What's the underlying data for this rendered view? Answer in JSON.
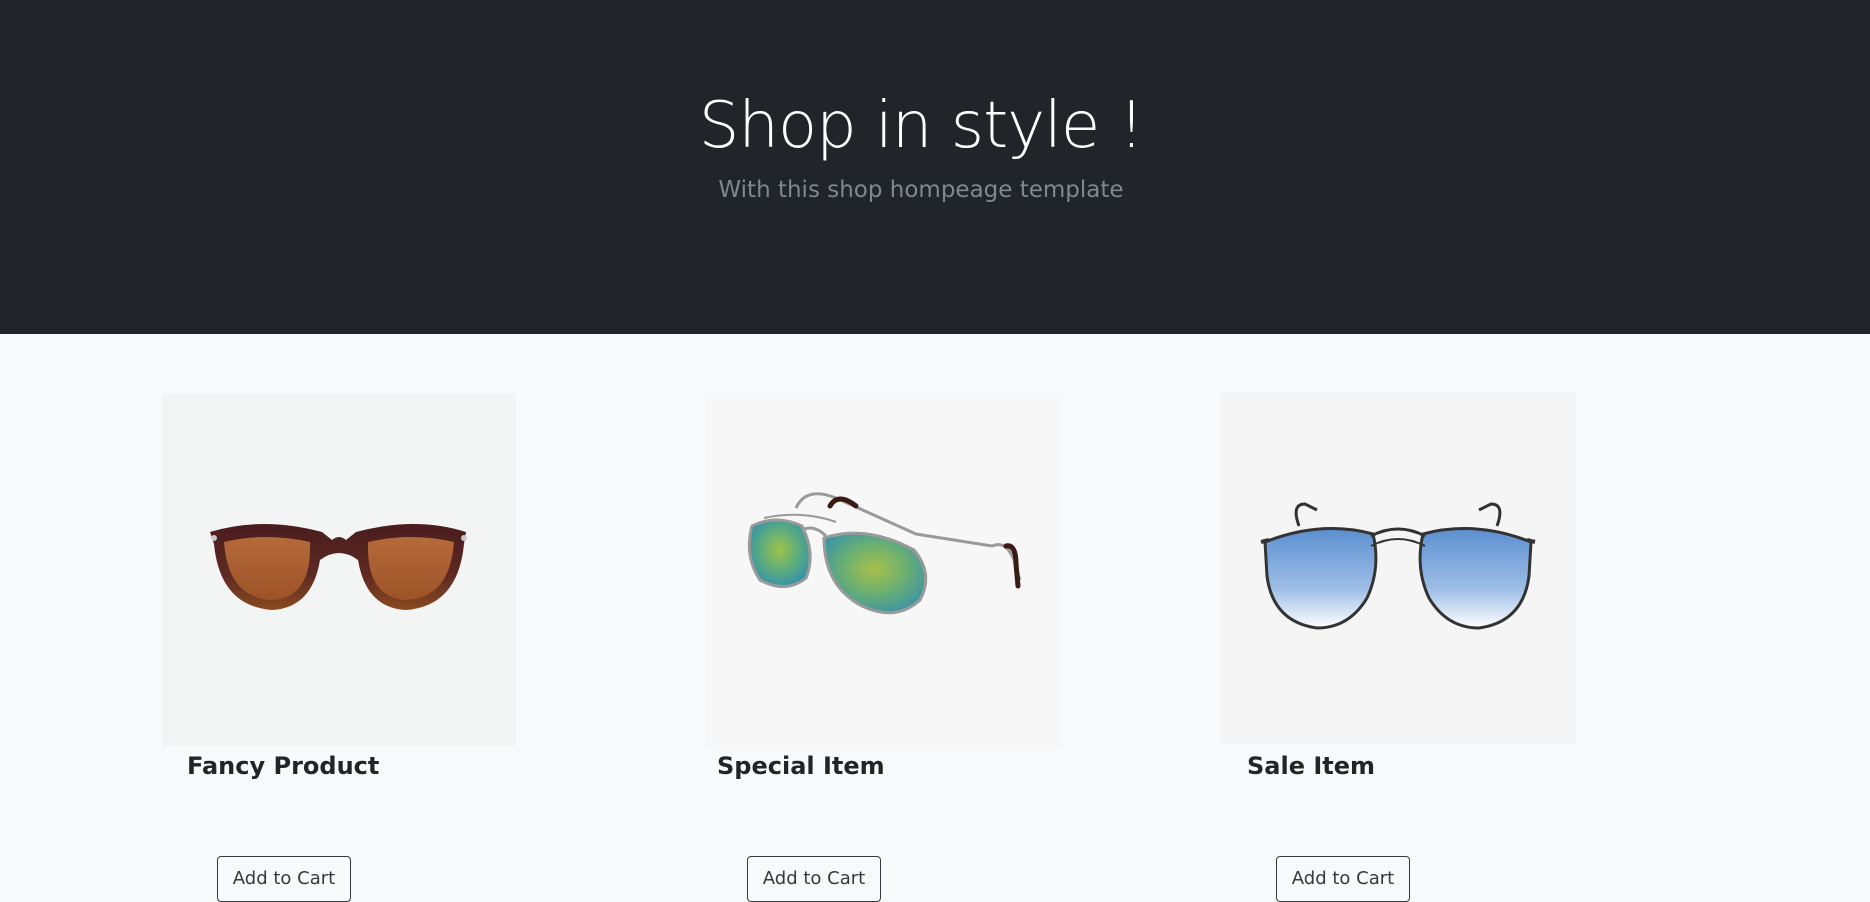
{
  "hero": {
    "title": "Shop in style !",
    "subtitle": "With this shop hompeage template"
  },
  "colors": {
    "hero_background": "#212529",
    "page_background": "#f8f9fa",
    "title_text": "#ffffff",
    "subtitle_text": "#80878e",
    "button_border": "#343a40"
  },
  "products": [
    {
      "name": "Fancy Product",
      "button_label": "Add to Cart",
      "image_icon": "round-brown-sunglasses-icon"
    },
    {
      "name": "Special Item",
      "button_label": "Add to Cart",
      "image_icon": "green-mirror-aviator-sunglasses-icon"
    },
    {
      "name": "Sale Item",
      "button_label": "Add to Cart",
      "image_icon": "blue-gradient-aviator-sunglasses-icon"
    }
  ]
}
